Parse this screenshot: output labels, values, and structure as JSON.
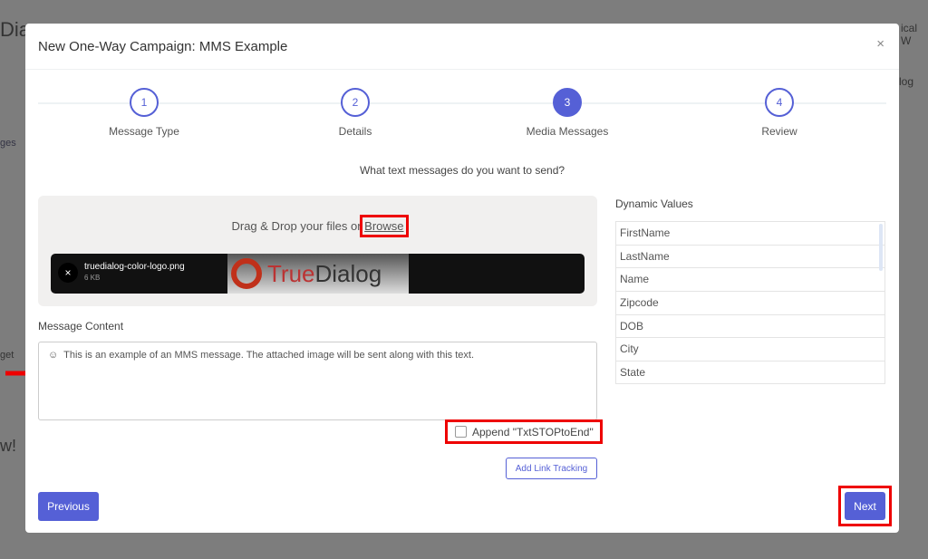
{
  "background": {
    "brand_fragment": "Dia",
    "user_fragment": "ical W",
    "tab_fragment": "log",
    "side_fragment": "ges",
    "side2": "get",
    "side3": "w!"
  },
  "modal": {
    "title": "New One-Way Campaign: MMS Example",
    "close": "×",
    "steps": [
      {
        "num": "1",
        "label": "Message Type"
      },
      {
        "num": "2",
        "label": "Details"
      },
      {
        "num": "3",
        "label": "Media Messages",
        "active": true
      },
      {
        "num": "4",
        "label": "Review"
      }
    ],
    "question": "What text messages do you want to send?",
    "dropzone": {
      "text": "Drag & Drop your files or ",
      "browse": "Browse"
    },
    "file": {
      "name": "truedialog-color-logo.png",
      "size": "6 KB",
      "remove": "×",
      "logo_text": "TrueDialog"
    },
    "message_content_label": "Message Content",
    "message_content": "This is an example of an MMS message. The attached image will be sent along with this text.",
    "append_label": "Append \"TxtSTOPtoEnd\"",
    "add_link_tracking": "Add Link Tracking",
    "previous": "Previous",
    "next": "Next",
    "dynamic_values_label": "Dynamic Values",
    "dynamic_values": [
      "FirstName",
      "LastName",
      "Name",
      "Zipcode",
      "DOB",
      "City",
      "State"
    ],
    "accent": "#5560d6",
    "highlight": "#e00000"
  }
}
